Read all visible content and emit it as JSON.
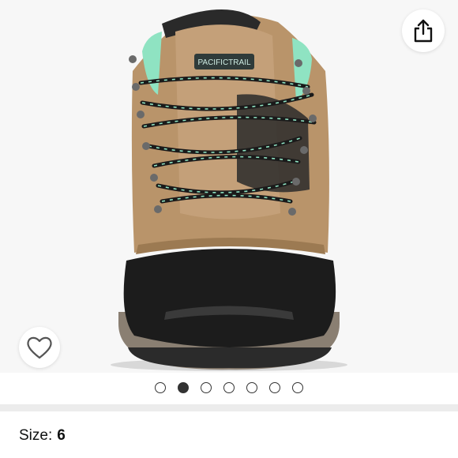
{
  "product": {
    "brand_logo_text": "PACIFICTRAIL",
    "size_label": "Size:",
    "size_value": "6"
  },
  "gallery": {
    "image_count": 7,
    "active_index": 1
  },
  "icons": {
    "share": "share-icon",
    "wishlist": "heart-outline-icon"
  },
  "colors": {
    "dot_active": "#333333",
    "boot_leather": "#b9946a",
    "boot_accent": "#8fe3c2"
  }
}
